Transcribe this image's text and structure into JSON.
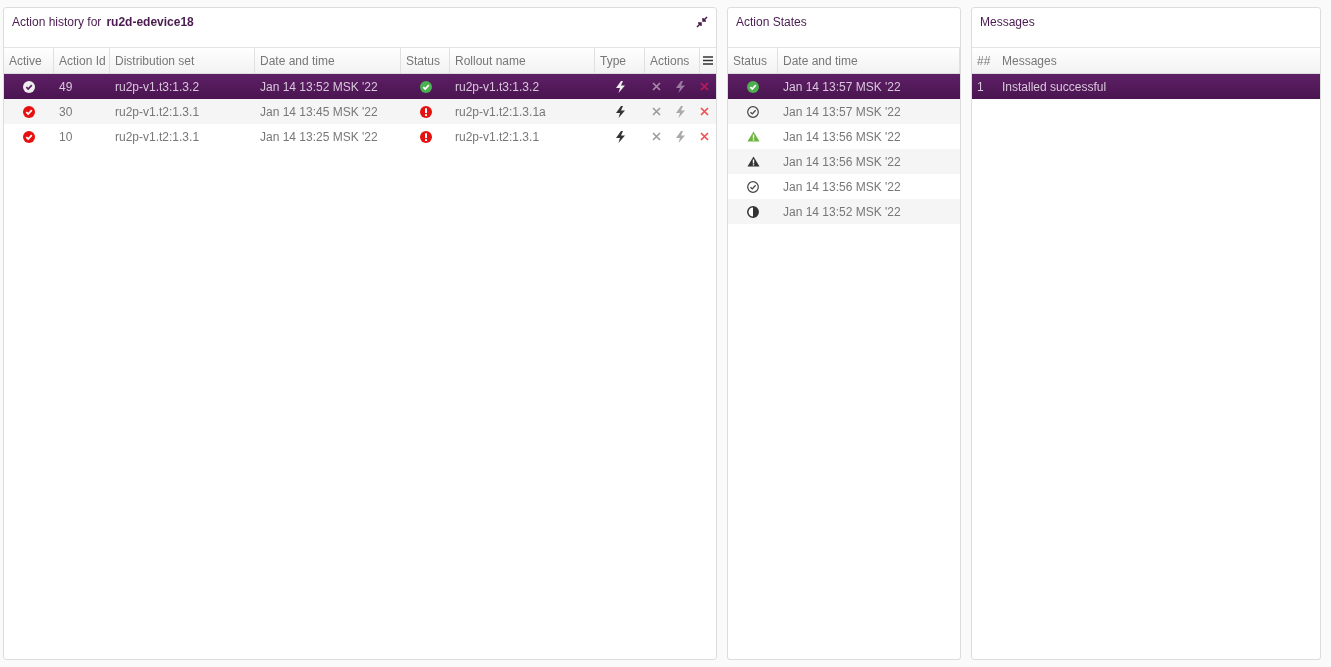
{
  "history": {
    "title": "Action history for",
    "device": "ru2d-edevice18",
    "columns": [
      "Active",
      "Action Id",
      "Distribution set",
      "Date and time",
      "Status",
      "Rollout name",
      "Type",
      "Actions"
    ],
    "rows": [
      {
        "selected": true,
        "active": true,
        "id": "49",
        "distribution": "ru2p-v1.t3:1.3.2",
        "date": "Jan 14 13:52 MSK '22",
        "status": {
          "kind": "finished"
        },
        "rollout": "ru2p-v1.t3:1.3.2"
      },
      {
        "selected": false,
        "active": true,
        "id": "30",
        "distribution": "ru2p-v1.t2:1.3.1",
        "date": "Jan 14 13:45 MSK '22",
        "status": {
          "kind": "error"
        },
        "rollout": "ru2p-v1.t2:1.3.1a"
      },
      {
        "selected": false,
        "active": true,
        "id": "10",
        "distribution": "ru2p-v1.t2:1.3.1",
        "date": "Jan 14 13:25 MSK '22",
        "status": {
          "kind": "error"
        },
        "rollout": "ru2p-v1.t2:1.3.1"
      }
    ]
  },
  "states": {
    "title": "Action States",
    "columns": [
      "Status",
      "Date and time"
    ],
    "rows": [
      {
        "selected": true,
        "kind": "finished",
        "date": "Jan 14 13:57 MSK '22"
      },
      {
        "selected": false,
        "kind": "check",
        "date": "Jan 14 13:57 MSK '22"
      },
      {
        "selected": false,
        "kind": "warning-green",
        "date": "Jan 14 13:56 MSK '22"
      },
      {
        "selected": false,
        "kind": "warning-dark",
        "date": "Jan 14 13:56 MSK '22"
      },
      {
        "selected": false,
        "kind": "check",
        "date": "Jan 14 13:56 MSK '22"
      },
      {
        "selected": false,
        "kind": "running",
        "date": "Jan 14 13:52 MSK '22"
      }
    ]
  },
  "messages": {
    "title": "Messages",
    "columns": [
      "##",
      "Messages"
    ],
    "rows": [
      {
        "selected": true,
        "number": "1",
        "text": "Installed successful"
      }
    ]
  }
}
